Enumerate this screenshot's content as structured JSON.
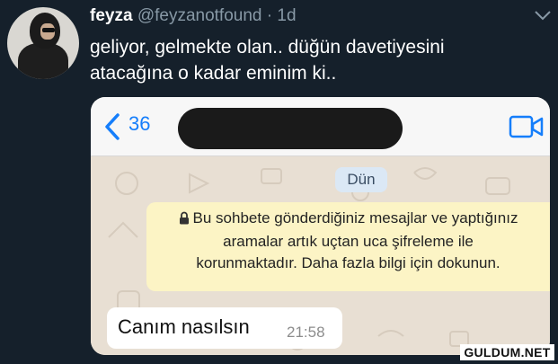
{
  "tweet": {
    "display_name": "feyza",
    "handle": "@feyzanotfound",
    "separator": "·",
    "time": "1d",
    "text_lines": [
      "geliyor, gelmekte olan.. düğün davetiyesini",
      "atacağına o kadar eminim ki.."
    ],
    "menu_icon": "chevron-down-icon",
    "avatar_icon": "avatar"
  },
  "screenshot": {
    "header": {
      "back_icon": "chevron-left-icon",
      "back_count": "36",
      "call_icon": "video-camera-icon"
    },
    "date_label": "Dün",
    "encryption_notice": {
      "icon": "lock-icon",
      "lines": [
        "Bu sohbete gönderdiğiniz mesajlar ve yaptığınız",
        "aramalar artık uçtan uca şifreleme ile",
        "korunmaktadır. Daha fazla bilgi için dokunun."
      ]
    },
    "message": {
      "text": "Canım nasılsın",
      "time": "21:58"
    }
  },
  "watermark": "GULDUM.NET",
  "colors": {
    "background": "#15202b",
    "secondary_text": "#8899a6",
    "ios_blue": "#157efb",
    "notice_bg": "#fcf4c5",
    "chat_wallpaper": "#e8dfd3"
  }
}
